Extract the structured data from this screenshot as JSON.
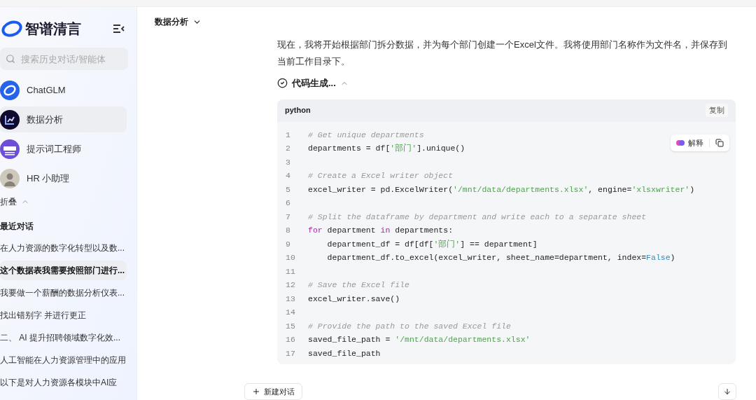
{
  "sidebar": {
    "logo": "智谱清言",
    "search": {
      "placeholder": "搜索历史对话/智能体"
    },
    "agents": [
      {
        "name": "ChatGLM",
        "kind": "ring",
        "selected": false
      },
      {
        "name": "数据分析",
        "kind": "chart",
        "selected": true
      },
      {
        "name": "提示词工程师",
        "kind": "prompt",
        "selected": false
      },
      {
        "name": "HR 小助理",
        "kind": "person",
        "selected": false
      }
    ],
    "collapse": {
      "label": "折叠"
    },
    "recent_title": "最近对话",
    "recent": [
      {
        "title": "在人力资源的数字化转型以及数...",
        "selected": false
      },
      {
        "title": "这个数据表我需要按照部门进行...",
        "selected": true
      },
      {
        "title": "我要做一个薪酬的数据分析仪表...",
        "selected": false
      },
      {
        "title": "找出错别字 并进行更正",
        "selected": false
      },
      {
        "title": "二、 AI 提升招聘领域数字化效...",
        "selected": false
      },
      {
        "title": "人工智能在人力资源管理中的应用",
        "selected": false
      },
      {
        "title": "以下是对人力资源各模块中AI应",
        "selected": false
      }
    ]
  },
  "header": {
    "title": "数据分析"
  },
  "message": {
    "text": "现在，我将开始根据部门拆分数据，并为每个部门创建一个Excel文件。我将使用部门名称作为文件名，并保存到当前工作目录下。",
    "step": "代码生成...",
    "code": {
      "language": "python",
      "copy": "复制",
      "explain": "解释",
      "lines": [
        {
          "no": "1",
          "tokens": [
            {
              "kind": "comment",
              "text": "# Get unique departments"
            }
          ]
        },
        {
          "no": "2",
          "tokens": [
            {
              "kind": "plain",
              "text": "departments = df["
            },
            {
              "kind": "string",
              "text": "'部门'"
            },
            {
              "kind": "plain",
              "text": "].unique()"
            }
          ]
        },
        {
          "no": "3"
        },
        {
          "no": "4",
          "tokens": [
            {
              "kind": "comment",
              "text": "# Create a Excel writer object"
            }
          ]
        },
        {
          "no": "5",
          "tokens": [
            {
              "kind": "plain",
              "text": "excel_writer = pd.ExcelWriter("
            },
            {
              "kind": "string",
              "text": "'/mnt/data/departments.xlsx'"
            },
            {
              "kind": "plain",
              "text": ", engine="
            },
            {
              "kind": "string",
              "text": "'xlsxwriter'"
            },
            {
              "kind": "plain",
              "text": ")"
            }
          ]
        },
        {
          "no": "6"
        },
        {
          "no": "7",
          "tokens": [
            {
              "kind": "comment",
              "text": "# Split the dataframe by department and write each to a separate sheet"
            }
          ]
        },
        {
          "no": "8",
          "tokens": [
            {
              "kind": "keyword",
              "text": "for"
            },
            {
              "kind": "plain",
              "text": " department "
            },
            {
              "kind": "keyword",
              "text": "in"
            },
            {
              "kind": "plain",
              "text": " departments:"
            }
          ]
        },
        {
          "no": "9",
          "tokens": [
            {
              "kind": "plain",
              "text": "    department_df = df[df["
            },
            {
              "kind": "string",
              "text": "'部门'"
            },
            {
              "kind": "plain",
              "text": "] == department]"
            }
          ]
        },
        {
          "no": "10",
          "tokens": [
            {
              "kind": "plain",
              "text": "    department_df.to_excel(excel_writer, sheet_name=department, index="
            },
            {
              "kind": "bool",
              "text": "False"
            },
            {
              "kind": "plain",
              "text": ")"
            }
          ]
        },
        {
          "no": "11"
        },
        {
          "no": "12",
          "tokens": [
            {
              "kind": "comment",
              "text": "# Save the Excel file"
            }
          ]
        },
        {
          "no": "13",
          "tokens": [
            {
              "kind": "plain",
              "text": "excel_writer.save()"
            }
          ]
        },
        {
          "no": "14"
        },
        {
          "no": "15",
          "tokens": [
            {
              "kind": "comment",
              "text": "# Provide the path to the saved Excel file"
            }
          ]
        },
        {
          "no": "16",
          "tokens": [
            {
              "kind": "plain",
              "text": "saved_file_path = "
            },
            {
              "kind": "string",
              "text": "'/mnt/data/departments.xlsx'"
            }
          ]
        },
        {
          "no": "17",
          "tokens": [
            {
              "kind": "plain",
              "text": "saved_file_path"
            }
          ]
        }
      ]
    }
  },
  "footer": {
    "new_chat": "新建对话"
  }
}
